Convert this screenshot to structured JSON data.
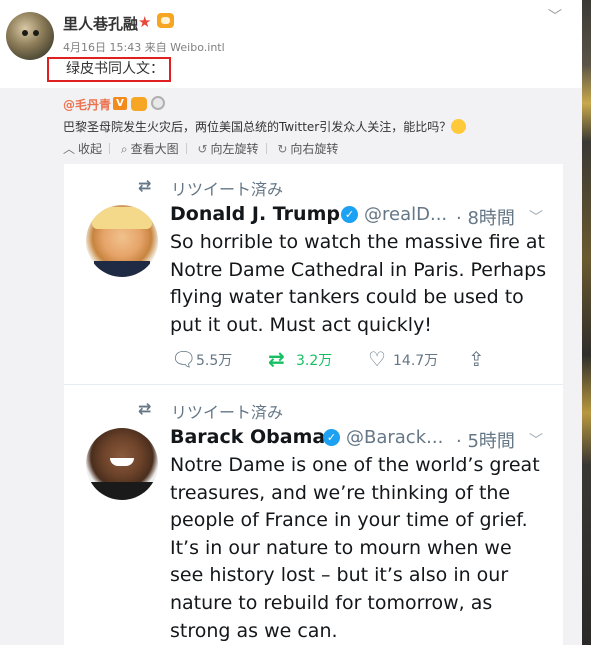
{
  "post": {
    "username": "里人巷孔融",
    "meta": "4月16日 15:43 来自 Weibo.intl",
    "content": "绿皮书同人文："
  },
  "repost": {
    "user": "@毛丹青",
    "text": "巴黎圣母院发生火灾后，两位美国总统的Twitter引发众人关注，能比吗？",
    "toolbar": [
      "收起",
      "查看大图",
      "向左旋转",
      "向右旋转"
    ]
  },
  "tweets": [
    {
      "retweet_label": "リツイート済み",
      "name": "Donald J. Trump",
      "handle": "@realD...",
      "time": "· 8時間",
      "body": "So horrible to watch the massive fire at Notre Dame Cathedral in Paris. Perhaps flying water tankers could be used to put it out. Must act quickly!",
      "replies": "5.5万",
      "retweets": "3.2万",
      "likes": "14.7万"
    },
    {
      "retweet_label": "リツイート済み",
      "name": "Barack Obama",
      "handle": "@Barack...",
      "time": "· 5時間",
      "body": "Notre Dame is one of the world’s great treasures, and we’re thinking of the people of France in your time of grief. It’s in our nature to mourn when we see history lost – but it’s also in our nature to rebuild for tomorrow, as strong as we can."
    }
  ],
  "colors": {
    "link_orange": "#eb7350",
    "retweet_green": "#17bf63",
    "verified_blue": "#1da1f2",
    "highlight_red": "#e02020"
  }
}
